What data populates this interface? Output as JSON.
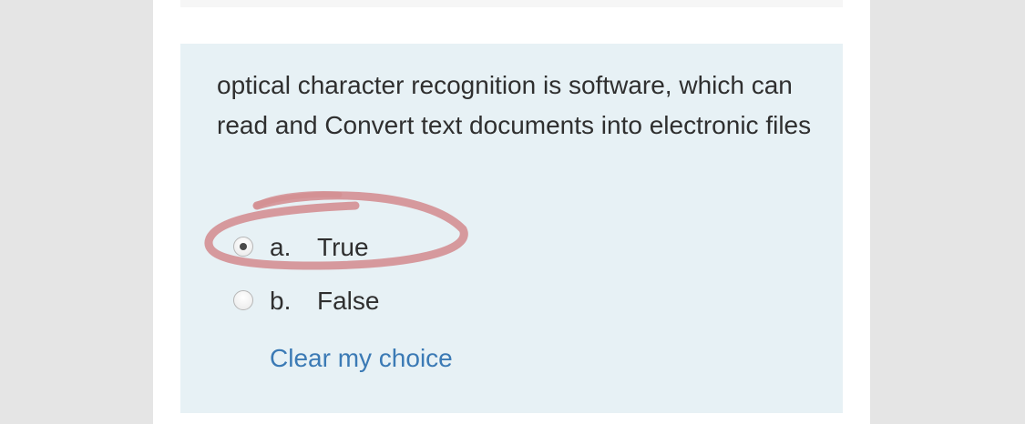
{
  "question": {
    "text": "optical character recognition is software, which can read and Convert text documents into electronic files",
    "options": [
      {
        "letter": "a.",
        "label": "True",
        "selected": true
      },
      {
        "letter": "b.",
        "label": "False",
        "selected": false
      }
    ],
    "clear_label": "Clear my choice"
  },
  "colors": {
    "panel_background": "#e7f1f5",
    "link": "#3b7ab5",
    "annotation": "#d48f93"
  }
}
